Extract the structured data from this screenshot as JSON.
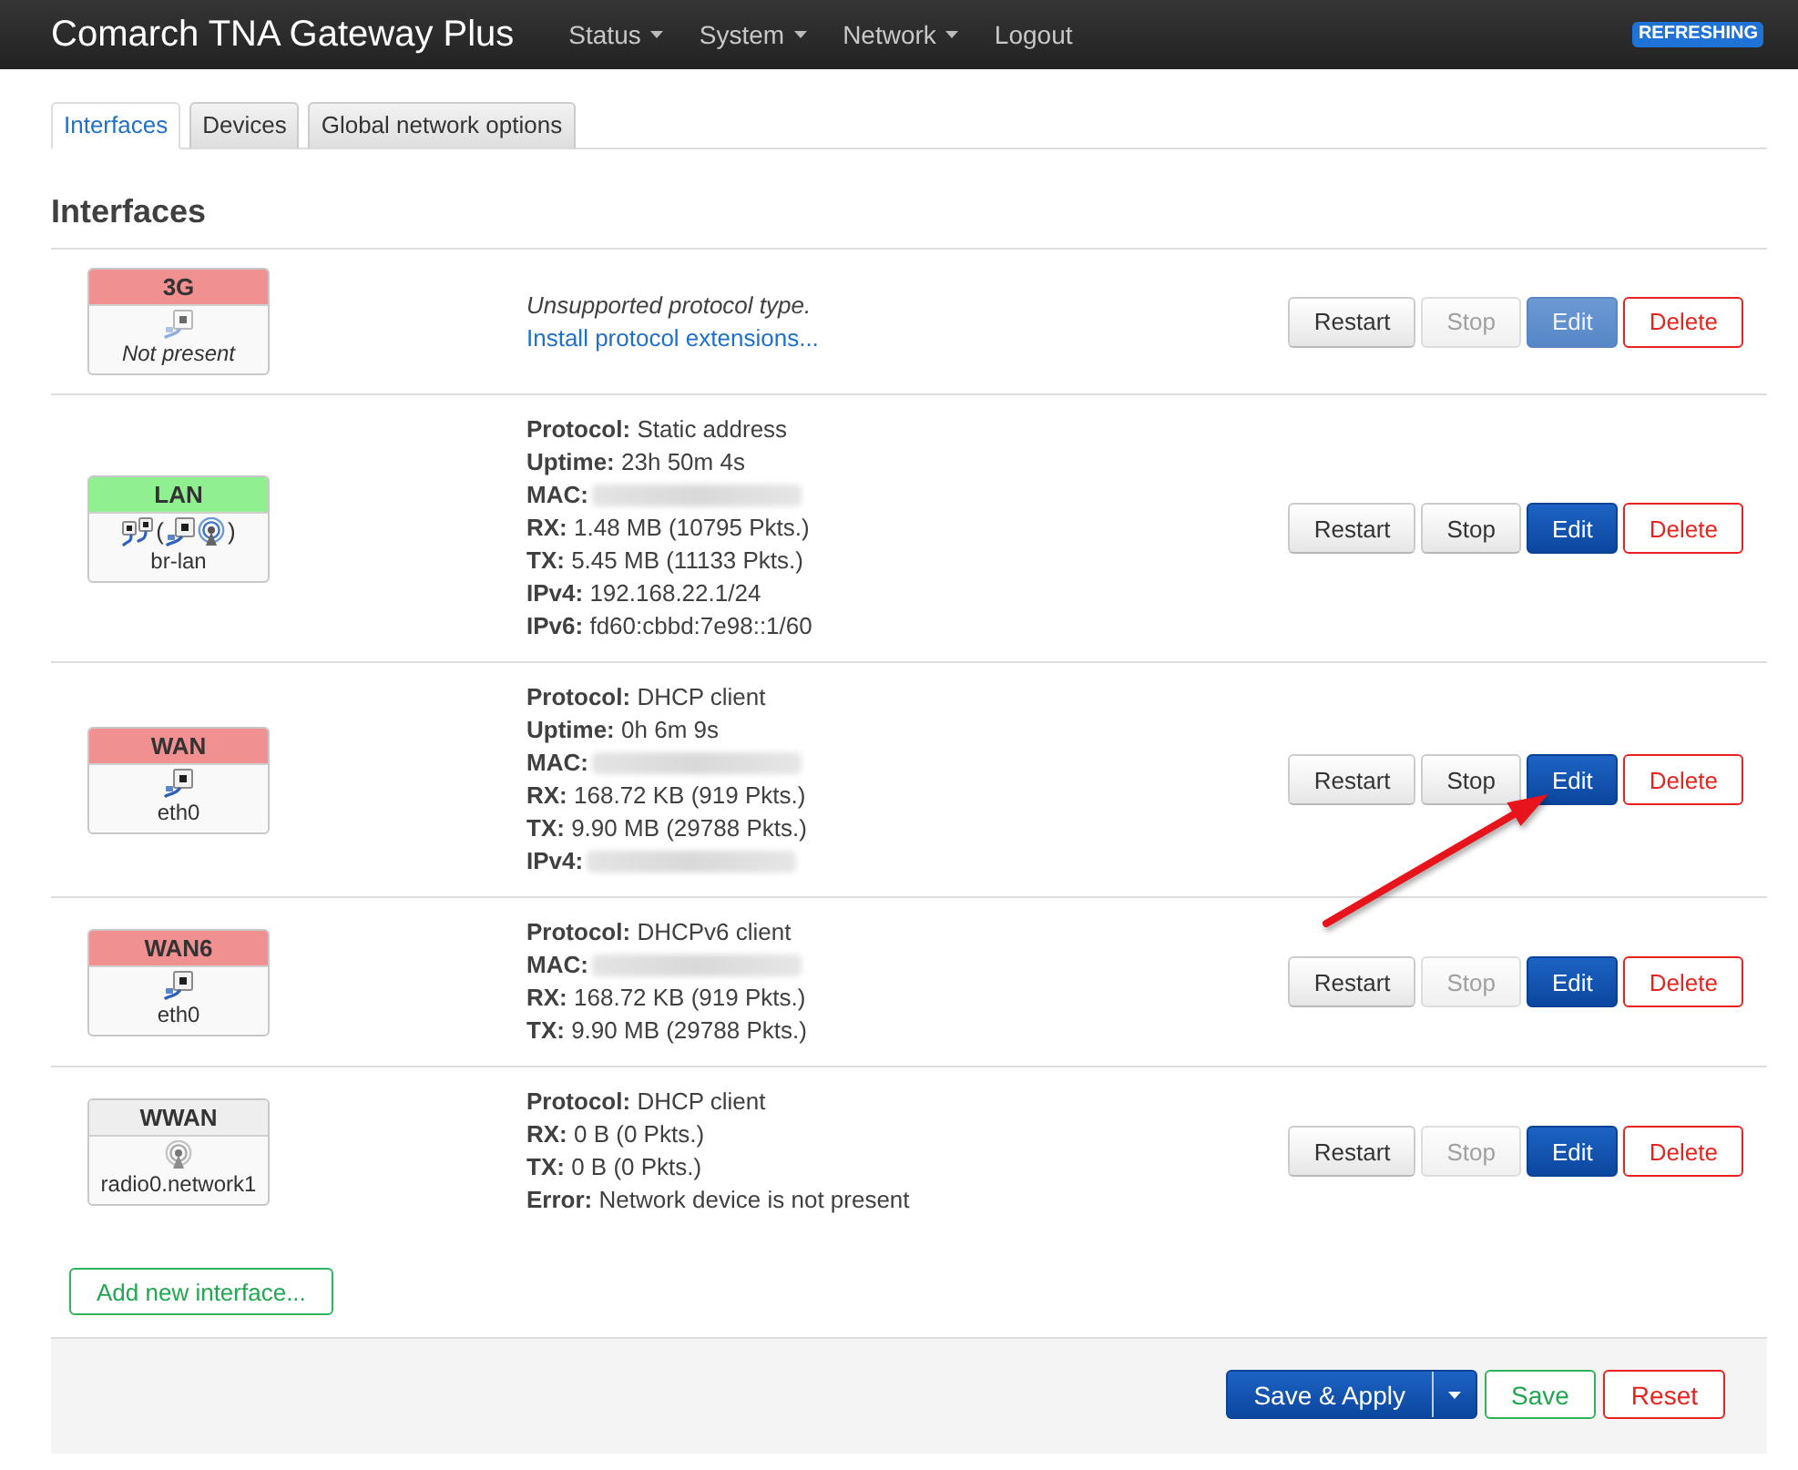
{
  "header": {
    "brand": "Comarch TNA Gateway Plus",
    "menu": [
      {
        "label": "Status",
        "dropdown": true
      },
      {
        "label": "System",
        "dropdown": true
      },
      {
        "label": "Network",
        "dropdown": true
      },
      {
        "label": "Logout",
        "dropdown": false
      }
    ],
    "status_badge": "REFRESHING"
  },
  "tabs": [
    {
      "label": "Interfaces",
      "selected": true
    },
    {
      "label": "Devices",
      "selected": false
    },
    {
      "label": "Global network options",
      "selected": false
    }
  ],
  "section_title": "Interfaces",
  "interfaces": [
    {
      "name": "3G",
      "color": "#f09090",
      "device": "Not present",
      "present": false,
      "icons": [
        {
          "kind": "ethernet",
          "disabled": true
        }
      ],
      "details": [
        {
          "kind": "note",
          "text": "Unsupported protocol type."
        },
        {
          "kind": "link",
          "text": "Install protocol extensions..."
        }
      ],
      "buttons": [
        {
          "label": "Restart",
          "kind": "neutral",
          "disabled": false
        },
        {
          "label": "Stop",
          "kind": "neutral",
          "disabled": true
        },
        {
          "label": "Edit",
          "kind": "primary",
          "disabled": true
        },
        {
          "label": "Delete",
          "kind": "danger",
          "disabled": false
        }
      ]
    },
    {
      "name": "LAN",
      "color": "#90f090",
      "device": "br-lan",
      "present": true,
      "icons": [
        {
          "kind": "bridge",
          "disabled": false,
          "open": "(",
          "close": ")",
          "members": [
            {
              "kind": "ethernet",
              "disabled": false
            },
            {
              "kind": "wireless",
              "disabled": false
            }
          ]
        }
      ],
      "details": [
        {
          "kind": "field",
          "label": "Protocol:",
          "value": "Static address"
        },
        {
          "kind": "field",
          "label": "Uptime:",
          "value": "23h 50m 4s"
        },
        {
          "kind": "redacted",
          "label": "MAC:"
        },
        {
          "kind": "field",
          "label": "RX:",
          "value": "1.48 MB (10795 Pkts.)"
        },
        {
          "kind": "field",
          "label": "TX:",
          "value": "5.45 MB (11133 Pkts.)"
        },
        {
          "kind": "field",
          "label": "IPv4:",
          "value": "192.168.22.1/24"
        },
        {
          "kind": "field",
          "label": "IPv6:",
          "value": "fd60:cbbd:7e98::1/60"
        }
      ],
      "buttons": [
        {
          "label": "Restart",
          "kind": "neutral",
          "disabled": false
        },
        {
          "label": "Stop",
          "kind": "neutral",
          "disabled": false
        },
        {
          "label": "Edit",
          "kind": "primary",
          "disabled": false
        },
        {
          "label": "Delete",
          "kind": "danger",
          "disabled": false
        }
      ]
    },
    {
      "name": "WAN",
      "color": "#f09090",
      "device": "eth0",
      "present": true,
      "icons": [
        {
          "kind": "ethernet",
          "disabled": false
        }
      ],
      "details": [
        {
          "kind": "field",
          "label": "Protocol:",
          "value": "DHCP client"
        },
        {
          "kind": "field",
          "label": "Uptime:",
          "value": "0h 6m 9s"
        },
        {
          "kind": "redacted",
          "label": "MAC:"
        },
        {
          "kind": "field",
          "label": "RX:",
          "value": "168.72 KB (919 Pkts.)"
        },
        {
          "kind": "field",
          "label": "TX:",
          "value": "9.90 MB (29788 Pkts.)"
        },
        {
          "kind": "redacted",
          "label": "IPv4:"
        }
      ],
      "buttons": [
        {
          "label": "Restart",
          "kind": "neutral",
          "disabled": false
        },
        {
          "label": "Stop",
          "kind": "neutral",
          "disabled": false
        },
        {
          "label": "Edit",
          "kind": "primary",
          "disabled": false
        },
        {
          "label": "Delete",
          "kind": "danger",
          "disabled": false
        }
      ]
    },
    {
      "name": "WAN6",
      "color": "#f09090",
      "device": "eth0",
      "present": true,
      "icons": [
        {
          "kind": "ethernet",
          "disabled": false
        }
      ],
      "details": [
        {
          "kind": "field",
          "label": "Protocol:",
          "value": "DHCPv6 client"
        },
        {
          "kind": "redacted",
          "label": "MAC:"
        },
        {
          "kind": "field",
          "label": "RX:",
          "value": "168.72 KB (919 Pkts.)"
        },
        {
          "kind": "field",
          "label": "TX:",
          "value": "9.90 MB (29788 Pkts.)"
        }
      ],
      "buttons": [
        {
          "label": "Restart",
          "kind": "neutral",
          "disabled": false
        },
        {
          "label": "Stop",
          "kind": "neutral",
          "disabled": true
        },
        {
          "label": "Edit",
          "kind": "primary",
          "disabled": false
        },
        {
          "label": "Delete",
          "kind": "danger",
          "disabled": false
        }
      ]
    },
    {
      "name": "WWAN",
      "color": "#eeeeee",
      "device": "radio0.network1",
      "present": true,
      "icons": [
        {
          "kind": "wireless",
          "disabled": true
        }
      ],
      "details": [
        {
          "kind": "field",
          "label": "Protocol:",
          "value": "DHCP client"
        },
        {
          "kind": "field",
          "label": "RX:",
          "value": "0 B (0 Pkts.)"
        },
        {
          "kind": "field",
          "label": "TX:",
          "value": "0 B (0 Pkts.)"
        },
        {
          "kind": "field",
          "label": "Error:",
          "value": "Network device is not present"
        }
      ],
      "buttons": [
        {
          "label": "Restart",
          "kind": "neutral",
          "disabled": false
        },
        {
          "label": "Stop",
          "kind": "neutral",
          "disabled": true
        },
        {
          "label": "Edit",
          "kind": "primary",
          "disabled": false
        },
        {
          "label": "Delete",
          "kind": "danger",
          "disabled": false
        }
      ]
    }
  ],
  "add_button": "Add new interface...",
  "actions": [
    {
      "label": "Save & Apply",
      "kind": "split"
    },
    {
      "label": "Save",
      "kind": "positive"
    },
    {
      "label": "Reset",
      "kind": "danger"
    }
  ]
}
